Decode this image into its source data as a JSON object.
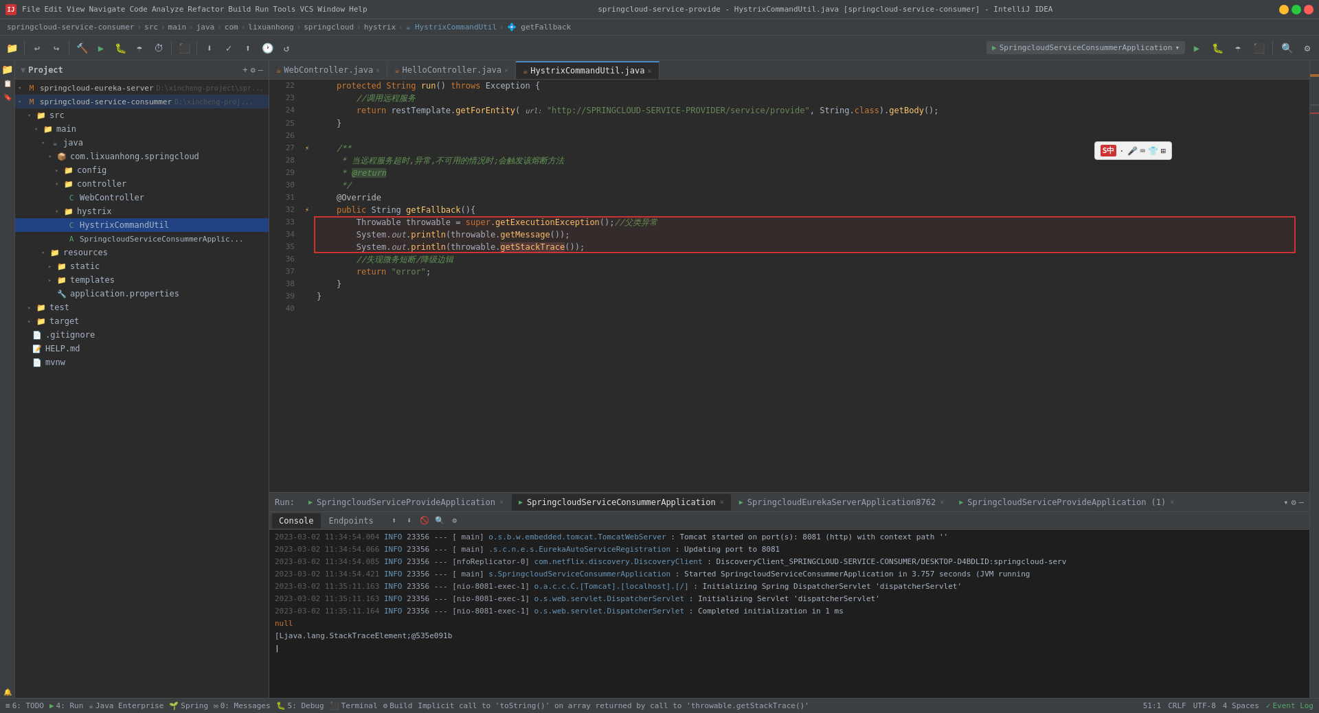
{
  "titlebar": {
    "title": "springcloud-service-provide - HystrixCommandUtil.java [springcloud-service-consumer] - IntelliJ IDEA",
    "app_label": "IJ"
  },
  "breadcrumb": {
    "parts": [
      "springcloud-service-consumer",
      "src",
      "main",
      "java",
      "com",
      "lixuanhong",
      "springcloud",
      "hystrix",
      "HystrixCommandUtil",
      "getFallback"
    ]
  },
  "run_config": {
    "label": "SpringcloudServiceConsummerApplication",
    "dropdown_arrow": "▾"
  },
  "project": {
    "title": "Project",
    "items": [
      {
        "label": "springcloud-eureka-server D:\\xincheng-project\\sp...",
        "indent": 0,
        "icon": "module",
        "expanded": true
      },
      {
        "label": "springcloud-service-consummer D:\\xincheng-proj...",
        "indent": 0,
        "icon": "module",
        "expanded": true
      },
      {
        "label": "src",
        "indent": 1,
        "icon": "folder",
        "expanded": true
      },
      {
        "label": "main",
        "indent": 2,
        "icon": "folder",
        "expanded": true
      },
      {
        "label": "java",
        "indent": 3,
        "icon": "folder",
        "expanded": true
      },
      {
        "label": "com.lixuanhong.springcloud",
        "indent": 4,
        "icon": "package",
        "expanded": true
      },
      {
        "label": "config",
        "indent": 5,
        "icon": "folder",
        "expanded": false
      },
      {
        "label": "controller",
        "indent": 5,
        "icon": "folder",
        "expanded": true
      },
      {
        "label": "WebController",
        "indent": 6,
        "icon": "class",
        "expanded": false
      },
      {
        "label": "hystrix",
        "indent": 5,
        "icon": "folder",
        "expanded": true
      },
      {
        "label": "HystrixCommandUtil",
        "indent": 6,
        "icon": "class",
        "selected": true
      },
      {
        "label": "SpringcloudServiceConsummerApplic...",
        "indent": 6,
        "icon": "class"
      },
      {
        "label": "resources",
        "indent": 3,
        "icon": "folder",
        "expanded": true
      },
      {
        "label": "static",
        "indent": 4,
        "icon": "folder"
      },
      {
        "label": "templates",
        "indent": 4,
        "icon": "folder"
      },
      {
        "label": "application.properties",
        "indent": 4,
        "icon": "properties"
      },
      {
        "label": "test",
        "indent": 1,
        "icon": "folder"
      },
      {
        "label": "target",
        "indent": 1,
        "icon": "folder"
      },
      {
        "label": ".gitignore",
        "indent": 1,
        "icon": "file"
      },
      {
        "label": "HELP.md",
        "indent": 1,
        "icon": "md"
      },
      {
        "label": "mvnw",
        "indent": 1,
        "icon": "file"
      }
    ]
  },
  "editor": {
    "tabs": [
      {
        "label": "WebController.java",
        "active": false,
        "icon": "java"
      },
      {
        "label": "HelloController.java",
        "active": false,
        "icon": "java"
      },
      {
        "label": "HystrixCommandUtil.java",
        "active": true,
        "icon": "java"
      }
    ],
    "lines": [
      {
        "num": 22,
        "content": "    protected String run() throws Exception {",
        "gutter": ""
      },
      {
        "num": 23,
        "content": "        //调用远程服务",
        "gutter": ""
      },
      {
        "num": 24,
        "content": "        return restTemplate.getForEntity( url: \"http://SPRINGCLOUD-SERVICE-PROVIDER/service/provide\", String.class).getBody();",
        "gutter": ""
      },
      {
        "num": 25,
        "content": "    }",
        "gutter": ""
      },
      {
        "num": 26,
        "content": "",
        "gutter": ""
      },
      {
        "num": 27,
        "content": "    /**",
        "gutter": "⚡"
      },
      {
        "num": 28,
        "content": "     * 当远程服务超时,异常,不可用的情况时;会触发该熔断方法",
        "gutter": ""
      },
      {
        "num": 29,
        "content": "     * @return",
        "gutter": ""
      },
      {
        "num": 30,
        "content": "     */",
        "gutter": ""
      },
      {
        "num": 31,
        "content": "@Override",
        "gutter": ""
      },
      {
        "num": 32,
        "content": "    public String getFallback(){",
        "gutter": "⚡"
      },
      {
        "num": 33,
        "content": "        Throwable throwable = super.getExecutionException();//父类异常",
        "gutter": ""
      },
      {
        "num": 34,
        "content": "        System.out.println(throwable.getMessage());",
        "gutter": ""
      },
      {
        "num": 35,
        "content": "        System.out.println(throwable.getStackTrace());",
        "gutter": ""
      },
      {
        "num": 36,
        "content": "        //失现微务短断/降级边辑",
        "gutter": ""
      },
      {
        "num": 37,
        "content": "        return \"error\";",
        "gutter": ""
      },
      {
        "num": 38,
        "content": "    }",
        "gutter": ""
      },
      {
        "num": 39,
        "content": "}",
        "gutter": ""
      },
      {
        "num": 40,
        "content": "",
        "gutter": ""
      }
    ]
  },
  "run_panel": {
    "label": "Run:",
    "tabs": [
      {
        "label": "SpringcloudServiceProvideApplication",
        "active": false
      },
      {
        "label": "SpringcloudServiceConsummerApplication",
        "active": true
      },
      {
        "label": "SpringcloudEurekaServerApplication8762",
        "active": false
      },
      {
        "label": "SpringcloudServiceProvideApplication (1)",
        "active": false
      }
    ],
    "console_tabs": [
      {
        "label": "Console",
        "active": true
      },
      {
        "label": "Endpoints",
        "active": false
      }
    ],
    "logs": [
      {
        "time": "2023-03-02 11:34:54.004",
        "level": "INFO",
        "pid": "23356",
        "thread": "[                 main]",
        "class": "o.s.b.w.embedded.tomcat.TomcatWebServer",
        "msg": ": Tomcat started on port(s): 8081 (http) with context path ''"
      },
      {
        "time": "2023-03-02 11:34:54.066",
        "level": "INFO",
        "pid": "23356",
        "thread": "[                 main]",
        "class": ".s.c.n.e.s.EurekaAutoServiceRegistration",
        "msg": ": Updating port to 8081"
      },
      {
        "time": "2023-03-02 11:34:54.085",
        "level": "INFO",
        "pid": "23356",
        "thread": "[nfoReplicator-0]",
        "class": "com.netflix.discovery.DiscoveryClient",
        "msg": ": DiscoveryClient_SPRINGCLOUD-SERVICE-CONSUMER/DESKTOP-D4BDLID:springcloud-serv"
      },
      {
        "time": "2023-03-02 11:34:54.421",
        "level": "INFO",
        "pid": "23356",
        "thread": "[                 main]",
        "class": "s.SpringcloudServiceConsummerApplication",
        "msg": ": Started SpringcloudServiceConsummerApplication in 3.757 seconds (JVM running"
      },
      {
        "time": "2023-03-02 11:35:11.163",
        "level": "INFO",
        "pid": "23356",
        "thread": "[nio-8081-exec-1]",
        "class": "o.a.c.c.C.[Tomcat].[localhost].[/]",
        "msg": ": Initializing Spring DispatcherServlet 'dispatcherServlet'"
      },
      {
        "time": "2023-03-02 11:35:11.163",
        "level": "INFO",
        "pid": "23356",
        "thread": "[nio-8081-exec-1]",
        "class": "o.s.web.servlet.DispatcherServlet",
        "msg": ": Initializing Servlet 'dispatcherServlet'"
      },
      {
        "time": "2023-03-02 11:35:11.164",
        "level": "INFO",
        "pid": "23356",
        "thread": "[nio-8081-exec-1]",
        "class": "o.s.web.servlet.DispatcherServlet",
        "msg": ": Completed initialization in 1 ms"
      },
      {
        "text": "null",
        "type": "null"
      },
      {
        "text": "[Ljava.lang.StackTraceElement;@535e091b",
        "type": "result"
      },
      {
        "text": "",
        "type": "cursor"
      }
    ]
  },
  "status_bar": {
    "left": [
      {
        "icon": "≡",
        "label": "6: TODO"
      },
      {
        "icon": "▶",
        "label": "4: Run"
      },
      {
        "icon": "☕",
        "label": "Java Enterprise"
      },
      {
        "icon": "🌱",
        "label": "Spring"
      },
      {
        "icon": "✉",
        "label": "0: Messages"
      },
      {
        "icon": "🐛",
        "label": "5: Debug"
      },
      {
        "icon": "⬛",
        "label": "Terminal"
      },
      {
        "icon": "⚙",
        "label": "Build"
      }
    ],
    "right": {
      "position": "51:1",
      "line_sep": "CRLF",
      "encoding": "UTF-8",
      "indent": "4 Spaces",
      "event_log": "Event Log",
      "git_icon": "✓"
    },
    "implicit_call": "Implicit call to 'toString()' on array returned by call to 'throwable.getStackTrace()'"
  },
  "ime": {
    "label": "S中",
    "icons": [
      "·",
      "🎤",
      "⌨",
      "👕",
      "⚄"
    ]
  }
}
